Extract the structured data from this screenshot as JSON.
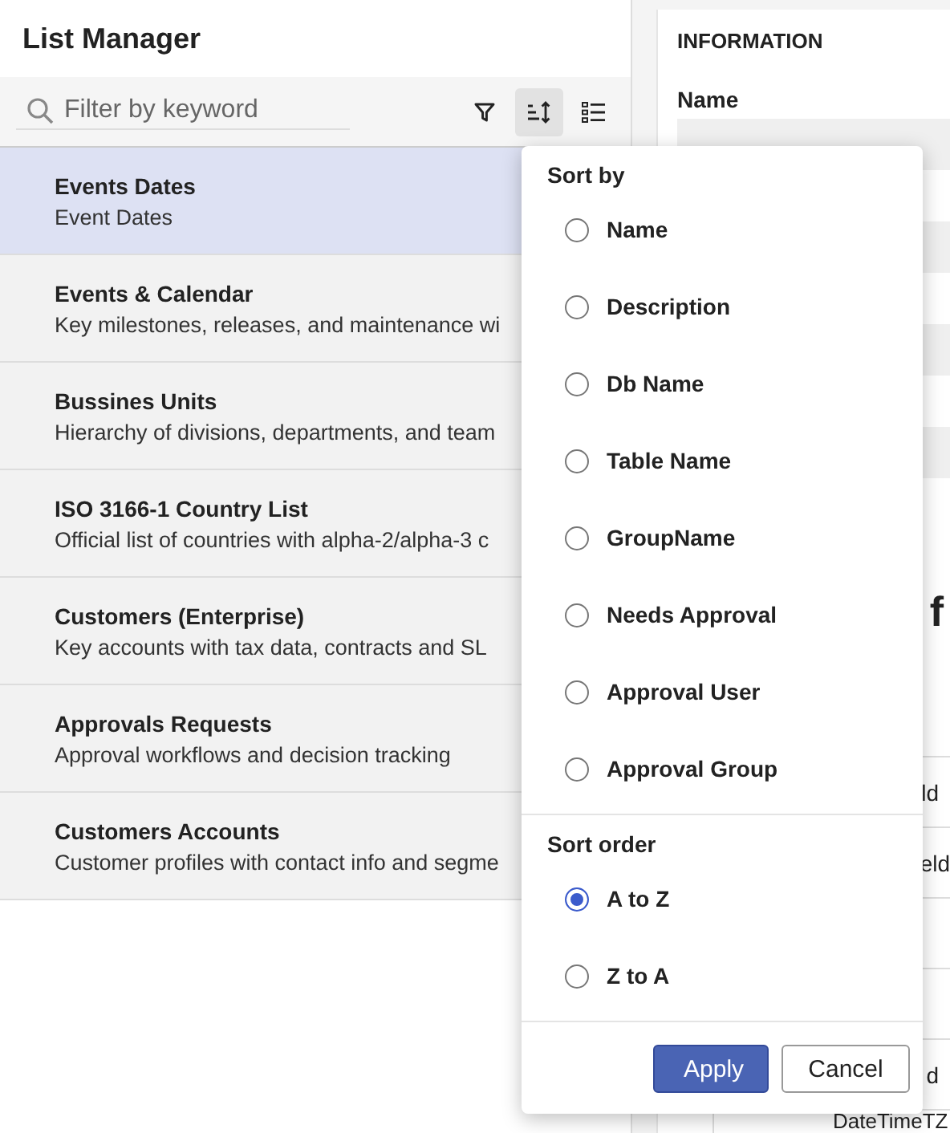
{
  "title": "List Manager",
  "search": {
    "placeholder": "Filter by keyword"
  },
  "toolbar": [
    {
      "kind": "filter",
      "selected": false
    },
    {
      "kind": "sort",
      "selected": true
    },
    {
      "kind": "list",
      "selected": false
    }
  ],
  "lists": [
    {
      "name": "Events Dates",
      "description": "Event Dates",
      "selected": true
    },
    {
      "name": "Events & Calendar",
      "description": "Key milestones, releases, and maintenance wi",
      "selected": false
    },
    {
      "name": "Bussines Units",
      "description": "Hierarchy of divisions, departments, and team",
      "selected": false
    },
    {
      "name": "ISO 3166-1 Country List",
      "description": "Official list of countries with alpha-2/alpha-3 c",
      "selected": false
    },
    {
      "name": "Customers (Enterprise)",
      "description": "Key accounts with tax data, contracts and SL",
      "selected": false
    },
    {
      "name": "Approvals Requests",
      "description": "Approval workflows and decision tracking",
      "selected": false
    },
    {
      "name": "Customers Accounts",
      "description": "Customer profiles with contact info and segme",
      "selected": false
    }
  ],
  "information": {
    "heading": "INFORMATION",
    "label": "Name",
    "fragments": [
      "f",
      "ld",
      "eld",
      "d",
      "DateTimeTZ"
    ]
  },
  "sort_menu": {
    "sort_by": {
      "title": "Sort by",
      "options": [
        {
          "label": "Name",
          "selected": false
        },
        {
          "label": "Description",
          "selected": false
        },
        {
          "label": "Db Name",
          "selected": false
        },
        {
          "label": "Table Name",
          "selected": false
        },
        {
          "label": "GroupName",
          "selected": false
        },
        {
          "label": "Needs Approval",
          "selected": false
        },
        {
          "label": "Approval User",
          "selected": false
        },
        {
          "label": "Approval Group",
          "selected": false
        }
      ]
    },
    "sort_order": {
      "title": "Sort order",
      "options": [
        {
          "label": "A to Z",
          "selected": true
        },
        {
          "label": "Z to A",
          "selected": false
        }
      ]
    },
    "buttons": [
      {
        "label": "Apply",
        "kind": "primary"
      },
      {
        "label": "Cancel",
        "kind": "secondary"
      }
    ]
  }
}
